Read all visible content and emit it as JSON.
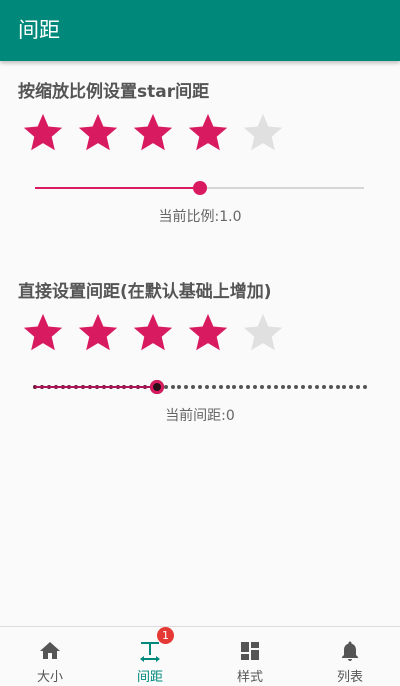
{
  "appbar": {
    "title": "间距"
  },
  "section1": {
    "title": "按缩放比例设置star间距",
    "rating": 4,
    "max_rating": 5,
    "slider_value": 0.5,
    "caption": "当前比例:1.0"
  },
  "section2": {
    "title": "直接设置间距(在默认基础上增加)",
    "rating": 4,
    "max_rating": 5,
    "slider_value": 0.37,
    "caption": "当前间距:0"
  },
  "colors": {
    "primary": "#00897b",
    "accent": "#d81b60",
    "star_empty": "#e0e0e0",
    "badge": "#e53935"
  },
  "bottom_nav": {
    "items": [
      {
        "label": "大小",
        "icon": "home-icon"
      },
      {
        "label": "间距",
        "icon": "spacing-icon",
        "badge": "1"
      },
      {
        "label": "样式",
        "icon": "dashboard-icon"
      },
      {
        "label": "列表",
        "icon": "bell-icon"
      }
    ]
  }
}
